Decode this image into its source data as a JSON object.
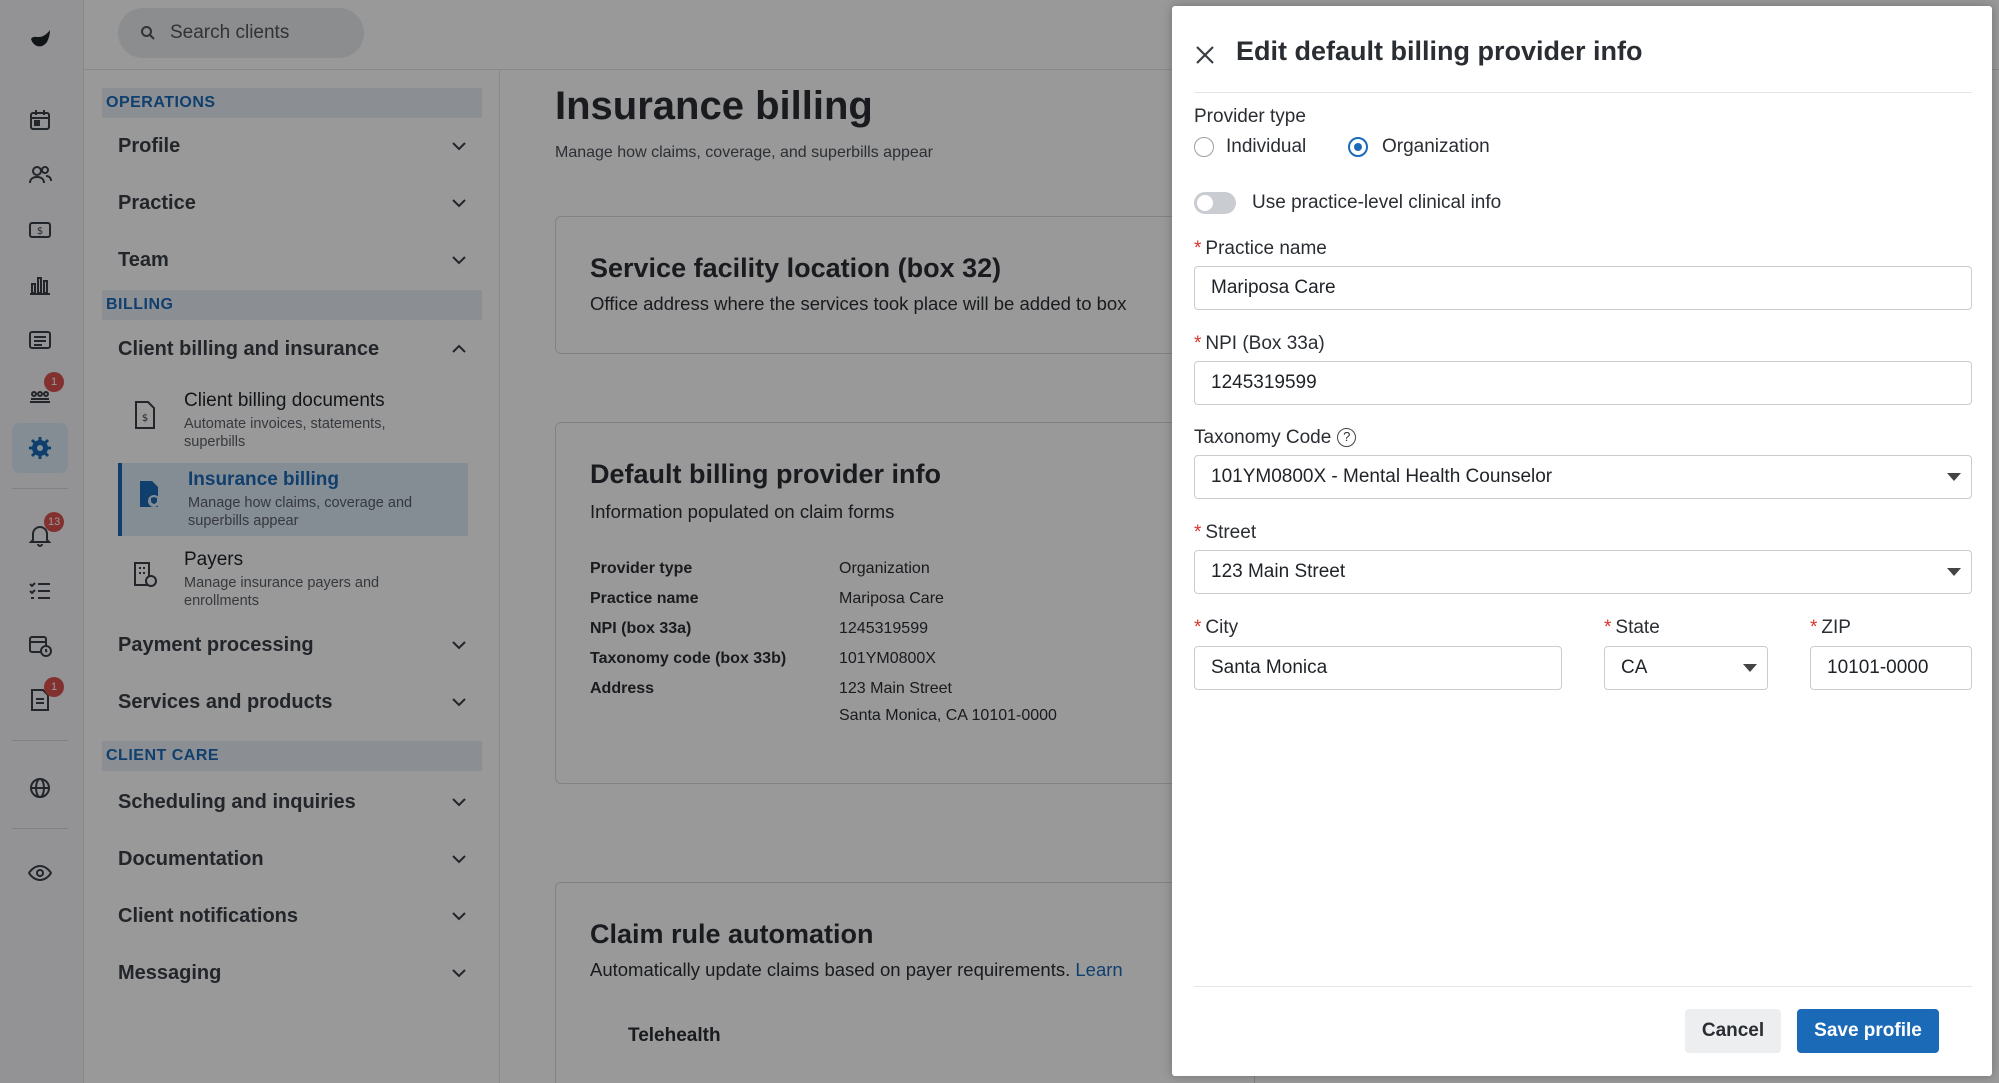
{
  "search": {
    "placeholder": "Search clients"
  },
  "rail": {
    "items": [
      {
        "icon": "logo-icon"
      },
      {
        "icon": "calendar-icon"
      },
      {
        "icon": "clients-icon"
      },
      {
        "icon": "billing-icon"
      },
      {
        "icon": "analytics-icon"
      },
      {
        "icon": "list-icon"
      },
      {
        "icon": "team-icon",
        "badge": "1"
      },
      {
        "icon": "gear-icon"
      },
      {
        "icon": "bell-icon",
        "badge": "13"
      },
      {
        "icon": "tasks-icon"
      },
      {
        "icon": "calendar-clock-icon"
      },
      {
        "icon": "report-icon",
        "badge": "1"
      },
      {
        "icon": "globe-icon"
      },
      {
        "icon": "eye-icon"
      }
    ]
  },
  "nav": {
    "operations_label": "OPERATIONS",
    "profile": "Profile",
    "practice": "Practice",
    "team": "Team",
    "billing_label": "BILLING",
    "client_billing": "Client billing and insurance",
    "sub_items": [
      {
        "title": "Client billing documents",
        "desc": "Automate invoices, statements, superbills"
      },
      {
        "title": "Insurance billing",
        "desc": "Manage how claims, coverage and superbills appear"
      },
      {
        "title": "Payers",
        "desc": "Manage insurance payers and enrollments"
      }
    ],
    "payment_processing": "Payment processing",
    "services_products": "Services and products",
    "client_care_label": "CLIENT CARE",
    "scheduling": "Scheduling and inquiries",
    "documentation": "Documentation",
    "client_notifications": "Client notifications",
    "messaging": "Messaging"
  },
  "main": {
    "title": "Insurance billing",
    "subtitle": "Manage how claims, coverage, and superbills appear",
    "service_facility": {
      "title": "Service facility location (box 32)",
      "subtitle": "Office address where the services took place will be added to box"
    },
    "default_billing": {
      "title": "Default billing provider info",
      "subtitle": "Information populated on claim forms",
      "rows": [
        {
          "label": "Provider type",
          "value": "Organization"
        },
        {
          "label": "Practice name",
          "value": "Mariposa Care"
        },
        {
          "label": "NPI (box 33a)",
          "value": "1245319599"
        },
        {
          "label": "Taxonomy code (box 33b)",
          "value": "101YM0800X"
        },
        {
          "label": "Address",
          "value": "123 Main Street"
        }
      ],
      "address_line2": "Santa Monica, CA 10101-0000"
    },
    "claim_rule": {
      "title": "Claim rule automation",
      "subtitle": "Automatically update claims based on payer requirements.",
      "learn_link": "Learn",
      "first_row": "Telehealth"
    }
  },
  "drawer": {
    "title": "Edit default billing provider info",
    "provider_type_label": "Provider type",
    "option_individual": "Individual",
    "option_organization": "Organization",
    "selected_option": "Organization",
    "toggle_label": "Use practice-level clinical info",
    "toggle_on": false,
    "practice_name_label": "Practice name",
    "practice_name_value": "Mariposa Care",
    "npi_label": "NPI (Box 33a)",
    "npi_value": "1245319599",
    "taxonomy_label": "Taxonomy Code",
    "taxonomy_value": "101YM0800X - Mental Health Counselor",
    "street_label": "Street",
    "street_value": "123 Main Street",
    "city_label": "City",
    "city_value": "Santa Monica",
    "state_label": "State",
    "state_value": "CA",
    "zip_label": "ZIP",
    "zip_value": "10101-0000",
    "cancel_label": "Cancel",
    "save_label": "Save profile",
    "required_marker": "*",
    "accent_color": "#1b6ab8",
    "arrow_color": "#2f8cf0"
  }
}
